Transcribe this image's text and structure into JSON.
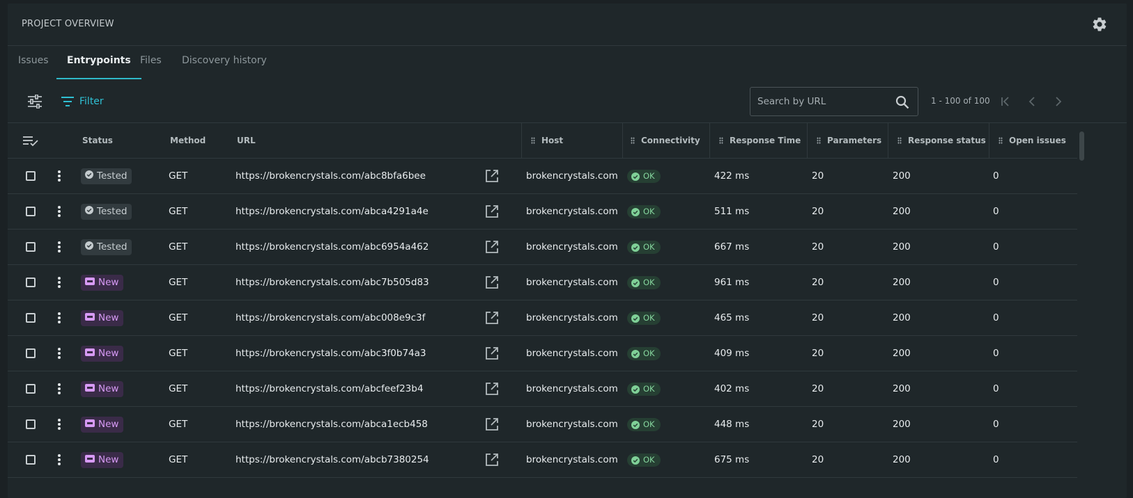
{
  "header": {
    "title": "PROJECT OVERVIEW"
  },
  "tabs": [
    {
      "label": "Issues",
      "active": false
    },
    {
      "label": "Entrypoints",
      "active": true
    },
    {
      "label": "Files",
      "active": false
    },
    {
      "label": "Discovery history",
      "active": false
    }
  ],
  "toolbar": {
    "filter_label": "Filter",
    "search_placeholder": "Search by URL",
    "pagination": "1 - 100 of 100"
  },
  "columns": {
    "status": "Status",
    "method": "Method",
    "url": "URL",
    "host": "Host",
    "connectivity": "Connectivity",
    "response_time": "Response Time",
    "parameters": "Parameters",
    "response_status": "Response status",
    "open_issues": "Open issues"
  },
  "rows": [
    {
      "status": "Tested",
      "method": "GET",
      "url": "https://brokencrystals.com/abc8bfa6bee",
      "host": "brokencrystals.com",
      "connectivity": "OK",
      "response_time": "422 ms",
      "parameters": "20",
      "response_status": "200",
      "open_issues": "0"
    },
    {
      "status": "Tested",
      "method": "GET",
      "url": "https://brokencrystals.com/abca4291a4e",
      "host": "brokencrystals.com",
      "connectivity": "OK",
      "response_time": "511 ms",
      "parameters": "20",
      "response_status": "200",
      "open_issues": "0"
    },
    {
      "status": "Tested",
      "method": "GET",
      "url": "https://brokencrystals.com/abc6954a462",
      "host": "brokencrystals.com",
      "connectivity": "OK",
      "response_time": "667 ms",
      "parameters": "20",
      "response_status": "200",
      "open_issues": "0"
    },
    {
      "status": "New",
      "method": "GET",
      "url": "https://brokencrystals.com/abc7b505d83",
      "host": "brokencrystals.com",
      "connectivity": "OK",
      "response_time": "961 ms",
      "parameters": "20",
      "response_status": "200",
      "open_issues": "0"
    },
    {
      "status": "New",
      "method": "GET",
      "url": "https://brokencrystals.com/abc008e9c3f",
      "host": "brokencrystals.com",
      "connectivity": "OK",
      "response_time": "465 ms",
      "parameters": "20",
      "response_status": "200",
      "open_issues": "0"
    },
    {
      "status": "New",
      "method": "GET",
      "url": "https://brokencrystals.com/abc3f0b74a3",
      "host": "brokencrystals.com",
      "connectivity": "OK",
      "response_time": "409 ms",
      "parameters": "20",
      "response_status": "200",
      "open_issues": "0"
    },
    {
      "status": "New",
      "method": "GET",
      "url": "https://brokencrystals.com/abcfeef23b4",
      "host": "brokencrystals.com",
      "connectivity": "OK",
      "response_time": "402 ms",
      "parameters": "20",
      "response_status": "200",
      "open_issues": "0"
    },
    {
      "status": "New",
      "method": "GET",
      "url": "https://brokencrystals.com/abca1ecb458",
      "host": "brokencrystals.com",
      "connectivity": "OK",
      "response_time": "448 ms",
      "parameters": "20",
      "response_status": "200",
      "open_issues": "0"
    },
    {
      "status": "New",
      "method": "GET",
      "url": "https://brokencrystals.com/abcb7380254",
      "host": "brokencrystals.com",
      "connectivity": "OK",
      "response_time": "675 ms",
      "parameters": "20",
      "response_status": "200",
      "open_issues": "0"
    }
  ],
  "colors": {
    "accent": "#2fc0d4",
    "tested_chip": "#323b3f",
    "new_chip": "#3a2b48",
    "ok_chip": "#263f33"
  },
  "icons": [
    "gear-icon",
    "tune-icon",
    "filter-icon",
    "search-icon",
    "first-page-icon",
    "prev-page-icon",
    "next-page-icon",
    "select-all-icon",
    "drag-handle-icon",
    "check-circle-icon",
    "new-badge-icon",
    "open-external-icon",
    "kebab-menu-icon"
  ]
}
